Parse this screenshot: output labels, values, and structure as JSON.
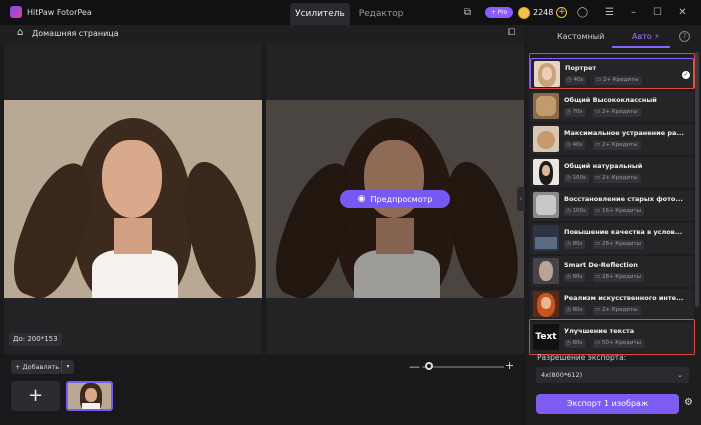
{
  "app": {
    "title": "HitPaw FotorPea"
  },
  "modes": [
    {
      "label": "Усилитель",
      "active": true
    },
    {
      "label": "Редактор",
      "active": false
    }
  ],
  "titlebar": {
    "pro_label": "+ Pro",
    "credits": "2248",
    "coin_plus": "+",
    "icons": [
      "export-square-icon",
      "user-circle-icon",
      "menu-icon",
      "minimize-icon",
      "maximize-icon",
      "close-icon"
    ]
  },
  "canvas": {
    "breadcrumb": "Домашняя страница",
    "preview_label": "Предпросмотр",
    "size_before": "До: 200*153"
  },
  "bottom": {
    "add_label": "+ Добавлять",
    "add_tile": "+"
  },
  "panel": {
    "tabs": [
      {
        "label": "Кастомный",
        "active": false
      },
      {
        "label": "Авто ⚡",
        "active": true
      }
    ],
    "help": "?",
    "items": [
      {
        "title": "Портрет",
        "time": "40s",
        "credits": "2+ Кредиты",
        "selected": true
      },
      {
        "title": "Общий Высококлассный",
        "time": "70s",
        "credits": "2+ Кредиты",
        "selected": false
      },
      {
        "title": "Максимальное устранение ра...",
        "time": "40s",
        "credits": "2+ Кредиты",
        "selected": false
      },
      {
        "title": "Общий натуральный",
        "time": "100s",
        "credits": "2+ Кредиты",
        "selected": false
      },
      {
        "title": "Восстановление старых фото...",
        "time": "100s",
        "credits": "16+ Кредиты",
        "selected": false
      },
      {
        "title": "Повышение качества в услов...",
        "time": "80s",
        "credits": "28+ Кредиты",
        "selected": false
      },
      {
        "title": "Smart De-Reflection",
        "time": "80s",
        "credits": "28+ Кредиты",
        "selected": false
      },
      {
        "title": "Реализм искусственного инте...",
        "time": "80s",
        "credits": "2+ Кредиты",
        "selected": false
      },
      {
        "title": "Улучшение текста",
        "time": "80s",
        "credits": "50+ Кредиты",
        "selected": false
      }
    ],
    "text_thumb_label": "Text",
    "export_resolution_label": "Разрешение экспорта:",
    "export_resolution_value": "4x(800*612)",
    "export_button": "Экспорт 1 изображ"
  },
  "colors": {
    "accent": "#7d5cf4",
    "highlight": "#e0493f",
    "background": "#1b1b1d"
  }
}
